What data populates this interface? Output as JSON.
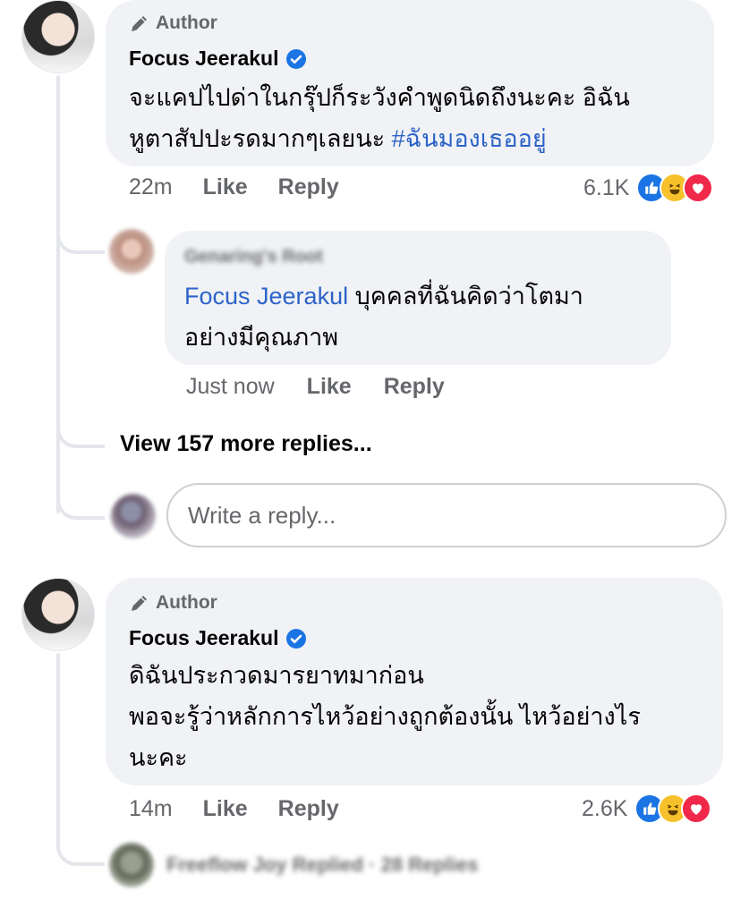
{
  "comments": [
    {
      "badge": "Author",
      "name": "Focus Jeerakul",
      "text_line1": "จะแคปไปด่าในกรุ๊ปก็ระวังคำพูดนิดถึงนะคะ อิฉัน",
      "text_line2_prefix": "หูตาสัปปะรดมากๆเลยนะ ",
      "hashtag": "#ฉันมองเธออยู่",
      "time": "22m",
      "like_label": "Like",
      "reply_label": "Reply",
      "reaction_count": "6.1K",
      "reply": {
        "name": "Genaring's Root",
        "mention": "Focus Jeerakul",
        "text_line1_suffix": " บุคคลที่ฉันคิดว่าโตมา",
        "text_line2": "อย่างมีคุณภาพ",
        "time": "Just now",
        "like_label": "Like",
        "reply_label": "Reply"
      },
      "view_more": "View 157 more replies...",
      "reply_placeholder": "Write a reply..."
    },
    {
      "badge": "Author",
      "name": "Focus Jeerakul",
      "text_line1": "ดิฉันประกวดมารยาทมาก่อน",
      "text_line2": "พอจะรู้ว่าหลักการไหว้อย่างถูกต้องนั้น ไหว้อย่างไร",
      "text_line3": "นะคะ",
      "time": "14m",
      "like_label": "Like",
      "reply_label": "Reply",
      "reaction_count": "2.6K",
      "replied_summary": "Freeflow Joy Replied · 28 Replies"
    }
  ],
  "icons": [
    "pencil-icon",
    "verified-badge-icon",
    "like-reaction-icon",
    "haha-reaction-icon",
    "love-reaction-icon"
  ],
  "colors": {
    "link": "#2d63c8",
    "bubble": "#f0f2f5",
    "meta": "#65676b",
    "like": "#1b74e4",
    "haha": "#f7c12b",
    "love": "#f0284a",
    "verified": "#1b74e4"
  }
}
